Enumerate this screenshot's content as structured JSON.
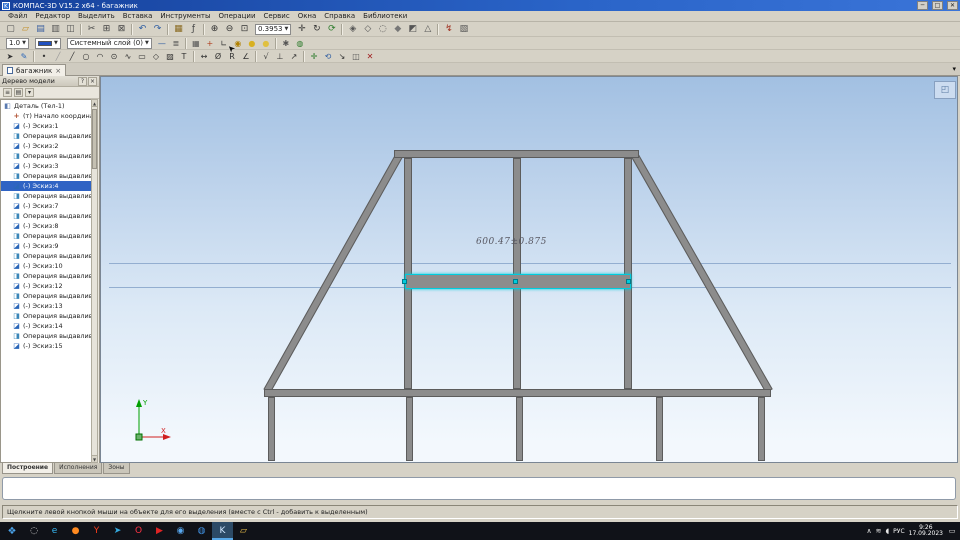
{
  "window": {
    "title": "КОМПАС-3D V15.2 x64 - багажник",
    "app_icon": "K",
    "buttons": {
      "minimize": "─",
      "maximize": "□",
      "close": "✕"
    }
  },
  "menu": {
    "items": [
      "Файл",
      "Редактор",
      "Выделить",
      "Вставка",
      "Инструменты",
      "Операции",
      "Сервис",
      "Окна",
      "Справка",
      "Библиотеки"
    ]
  },
  "toolbar1": {
    "zoom_value": "0.3953",
    "icons": [
      {
        "n": "new-document-button",
        "g": "▢",
        "c": "#555555"
      },
      {
        "n": "open-document-button",
        "g": "▱",
        "c": "#c08a20"
      },
      {
        "n": "save-button",
        "g": "▤",
        "c": "#3a5fa0"
      },
      {
        "n": "print-button",
        "g": "▥",
        "c": "#555555"
      },
      {
        "n": "print-preview-button",
        "g": "◫",
        "c": "#555555"
      },
      {
        "n": "separator",
        "sep": true
      },
      {
        "n": "cut-button",
        "g": "✂",
        "c": "#444444"
      },
      {
        "n": "copy-button",
        "g": "⊞",
        "c": "#444444"
      },
      {
        "n": "paste-button",
        "g": "⊠",
        "c": "#444444"
      },
      {
        "n": "separator",
        "sep": true
      },
      {
        "n": "undo-button",
        "g": "↶",
        "c": "#2a5aa0"
      },
      {
        "n": "redo-button",
        "g": "↷",
        "c": "#2a5aa0"
      },
      {
        "n": "separator",
        "sep": true
      },
      {
        "n": "library-manager-button",
        "g": "▦",
        "c": "#8a6a20"
      },
      {
        "n": "variables-button",
        "g": "ƒ",
        "c": "#444444"
      },
      {
        "n": "separator",
        "sep": true
      },
      {
        "n": "zoom-in-button",
        "g": "⊕",
        "c": "#333333"
      },
      {
        "n": "zoom-out-button",
        "g": "⊖",
        "c": "#333333"
      },
      {
        "n": "zoom-window-button",
        "g": "⊡",
        "c": "#333333"
      }
    ],
    "icons2": [
      {
        "n": "pan-button",
        "g": "✛",
        "c": "#333333"
      },
      {
        "n": "rotate-view-button",
        "g": "↻",
        "c": "#333333"
      },
      {
        "n": "refresh-button",
        "g": "⟳",
        "c": "#2a7a2a"
      },
      {
        "n": "separator",
        "sep": true
      },
      {
        "n": "orientation-button",
        "g": "◈",
        "c": "#555555"
      },
      {
        "n": "wireframe-button",
        "g": "◇",
        "c": "#555555"
      },
      {
        "n": "hidden-lines-button",
        "g": "◌",
        "c": "#555555"
      },
      {
        "n": "shaded-button",
        "g": "◆",
        "c": "#777777"
      },
      {
        "n": "shaded-edges-button",
        "g": "◩",
        "c": "#555555"
      },
      {
        "n": "perspective-button",
        "g": "△",
        "c": "#555555"
      },
      {
        "n": "separator",
        "sep": true
      },
      {
        "n": "rebuild-button",
        "g": "↯",
        "c": "#a03020"
      },
      {
        "n": "hide-surfaces-button",
        "g": "▧",
        "c": "#555555"
      }
    ]
  },
  "toolbar2": {
    "line_width": "1.0",
    "layer": "Системный слой (0)",
    "color_swatch": "#2050c0",
    "icons": [
      {
        "n": "line-style-button",
        "g": "—",
        "c": "#2a5aa0"
      },
      {
        "n": "layers-button",
        "g": "≣",
        "c": "#555555"
      },
      {
        "n": "separator",
        "sep": true
      },
      {
        "n": "grid-button",
        "g": "▦",
        "c": "#555555"
      },
      {
        "n": "local-cs-button",
        "g": "+",
        "c": "#b04020"
      },
      {
        "n": "ortho-button",
        "g": "∟",
        "c": "#333333"
      },
      {
        "n": "snap-settings-button",
        "g": "◉",
        "c": "#b08000"
      },
      {
        "n": "rounding-button",
        "g": "●",
        "c": "#d8b020"
      },
      {
        "n": "highlight-button",
        "g": "●",
        "c": "#e0c040"
      },
      {
        "n": "separator",
        "sep": true
      },
      {
        "n": "document-properties-button",
        "g": "✱",
        "c": "#555555"
      },
      {
        "n": "check-document-button",
        "g": "◍",
        "c": "#2a7a2a"
      }
    ]
  },
  "toolbar3": {
    "icons": [
      {
        "n": "pointer-button",
        "g": "➤",
        "c": "#333333"
      },
      {
        "n": "sketch-mode-button",
        "g": "✎",
        "c": "#2a66b8"
      },
      {
        "n": "separator",
        "sep": true
      },
      {
        "n": "point-button",
        "g": "•",
        "c": "#333333"
      },
      {
        "n": "auxiliary-line-button",
        "g": "╱",
        "c": "#999999"
      },
      {
        "n": "line-segment-button",
        "g": "╱",
        "c": "#333333"
      },
      {
        "n": "circle-button",
        "g": "○",
        "c": "#333333"
      },
      {
        "n": "arc-button",
        "g": "◠",
        "c": "#333333"
      },
      {
        "n": "ellipse-button",
        "g": "⊙",
        "c": "#333333"
      },
      {
        "n": "spline-button",
        "g": "∿",
        "c": "#333333"
      },
      {
        "n": "rectangle-button",
        "g": "▭",
        "c": "#333333"
      },
      {
        "n": "polygon-button",
        "g": "◇",
        "c": "#333333"
      },
      {
        "n": "hatch-button",
        "g": "▨",
        "c": "#333333"
      },
      {
        "n": "text-button",
        "g": "T",
        "c": "#333333"
      },
      {
        "n": "separator",
        "sep": true
      },
      {
        "n": "linear-dimension-button",
        "g": "↔",
        "c": "#333333"
      },
      {
        "n": "diameter-dimension-button",
        "g": "Ø",
        "c": "#333333"
      },
      {
        "n": "radius-dimension-button",
        "g": "R",
        "c": "#333333"
      },
      {
        "n": "angle-dimension-button",
        "g": "∠",
        "c": "#333333"
      },
      {
        "n": "separator",
        "sep": true
      },
      {
        "n": "roughness-button",
        "g": "√",
        "c": "#333333"
      },
      {
        "n": "perpendicular-button",
        "g": "⊥",
        "c": "#333333"
      },
      {
        "n": "leader-button",
        "g": "↗",
        "c": "#333333"
      },
      {
        "n": "separator",
        "sep": true
      },
      {
        "n": "move-button",
        "g": "✛",
        "c": "#2a7a2a"
      },
      {
        "n": "rotate-button",
        "g": "⟲",
        "c": "#2a5aa0"
      },
      {
        "n": "scale-button",
        "g": "↘",
        "c": "#333333"
      },
      {
        "n": "mirror-button",
        "g": "◫",
        "c": "#555555"
      },
      {
        "n": "delete-button",
        "g": "✕",
        "c": "#a02020"
      }
    ]
  },
  "doc_tab": {
    "label": "багажник",
    "close": "×"
  },
  "tab_overflow": "▾",
  "tree": {
    "title": "Дерево модели",
    "header_buttons": [
      {
        "n": "panel-help-button",
        "g": "?"
      },
      {
        "n": "panel-close-button",
        "g": "×"
      }
    ],
    "toolbar": [
      {
        "n": "tree-structure-button",
        "g": "≡"
      },
      {
        "n": "tree-view-button",
        "g": "▤"
      },
      {
        "n": "tree-filter-button",
        "g": "▾"
      }
    ],
    "scrollbar": {
      "up": "▲",
      "down": "▼"
    },
    "items": [
      {
        "label": "Деталь (Тел-1)",
        "icon": "part",
        "root": true
      },
      {
        "label": "(т) Начало координат",
        "icon": "origin"
      },
      {
        "label": "(-) Эскиз:1",
        "icon": "sketch"
      },
      {
        "label": "Операция выдавливания",
        "icon": "extrude"
      },
      {
        "label": "(-) Эскиз:2",
        "icon": "sketch"
      },
      {
        "label": "Операция выдавливания",
        "icon": "extrude"
      },
      {
        "label": "(-) Эскиз:3",
        "icon": "sketch"
      },
      {
        "label": "Операция выдавливания",
        "icon": "extrude"
      },
      {
        "label": "(-) Эскиз:4",
        "icon": "sketch",
        "selected": true
      },
      {
        "label": "Операция выдавливания",
        "icon": "extrude"
      },
      {
        "label": "(-) Эскиз:7",
        "icon": "sketch"
      },
      {
        "label": "Операция выдавливания",
        "icon": "extrude"
      },
      {
        "label": "(-) Эскиз:8",
        "icon": "sketch"
      },
      {
        "label": "Операция выдавливания",
        "icon": "extrude"
      },
      {
        "label": "(-) Эскиз:9",
        "icon": "sketch"
      },
      {
        "label": "Операция выдавливания",
        "icon": "extrude"
      },
      {
        "label": "(-) Эскиз:10",
        "icon": "sketch"
      },
      {
        "label": "Операция выдавливания",
        "icon": "extrude"
      },
      {
        "label": "(-) Эскиз:12",
        "icon": "sketch"
      },
      {
        "label": "Операция выдавливания",
        "icon": "extrude"
      },
      {
        "label": "(-) Эскиз:13",
        "icon": "sketch"
      },
      {
        "label": "Операция выдавливания",
        "icon": "extrude"
      },
      {
        "label": "(-) Эскиз:14",
        "icon": "sketch"
      },
      {
        "label": "Операция выдавливания",
        "icon": "extrude"
      },
      {
        "label": "(-) Эскиз:15",
        "icon": "sketch"
      }
    ]
  },
  "mode_tabs": [
    {
      "label": "Построение",
      "active": true
    },
    {
      "label": "Исполнения"
    },
    {
      "label": "Зоны"
    }
  ],
  "viewport": {
    "dimension": "600.47±0.875",
    "axis_x": "X",
    "axis_y": "Y",
    "orientation_glyph": "◰",
    "colors": {
      "frame": "#8c8c8c",
      "selection": "#00ccdd",
      "background_top": "#a2c0e2",
      "background_bottom": "#f3f8fd"
    }
  },
  "status": {
    "message": "Щелкните левой кнопкой мыши на объекте для его выделения (вместе с Ctrl - добавить к выделенным)"
  },
  "taskbar": {
    "start_glyph": "❖",
    "search_glyph": "◌",
    "apps": [
      {
        "n": "taskbar-edge",
        "g": "e",
        "c": "#38b6f0"
      },
      {
        "n": "taskbar-firefox",
        "g": "●",
        "c": "#ff8a20"
      },
      {
        "n": "taskbar-yandex",
        "g": "Y",
        "c": "#fc3f1d"
      },
      {
        "n": "taskbar-telegram",
        "g": "➤",
        "c": "#34aadf"
      },
      {
        "n": "taskbar-opera",
        "g": "O",
        "c": "#ff3344"
      },
      {
        "n": "taskbar-youtube",
        "g": "▶",
        "c": "#e02424"
      },
      {
        "n": "taskbar-chrome",
        "g": "◉",
        "c": "#58a8f0"
      },
      {
        "n": "taskbar-browser",
        "g": "◍",
        "c": "#4090e0"
      },
      {
        "n": "taskbar-kompas",
        "g": "K",
        "c": "#cfe6ff",
        "active": true
      },
      {
        "n": "taskbar-explorer",
        "g": "▱",
        "c": "#f6c84c"
      }
    ],
    "tray": {
      "expand": "∧",
      "network": "≋",
      "volume": "◖",
      "lang": "РУС",
      "time": "9:26",
      "date": "17.09.2023",
      "notification": "▭"
    }
  }
}
